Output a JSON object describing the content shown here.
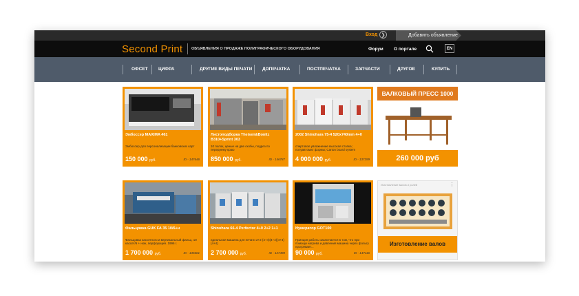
{
  "topbar": {
    "login": "Вход",
    "add_ad": "Добавить объявление"
  },
  "header": {
    "logo": "Second Print",
    "tagline": "ОБЪЯВЛЕНИЯ О ПРОДАЖЕ ПОЛИГРАФИЧЕСКОГО ОБОРУДОВАНИЯ",
    "forum": "Форум",
    "about": "О портале",
    "lang": "EN"
  },
  "nav": [
    "ОФСЕТ",
    "ЦИФРА",
    "ДРУГИЕ ВИДЫ ПЕЧАТИ",
    "ДОПЕЧАТКА",
    "ПОСТПЕЧАТКА",
    "ЗАПЧАСТИ",
    "ДРУГОЕ",
    "КУПИТЬ"
  ],
  "cards": [
    {
      "title": "Эмбоссер MAXIMA 461",
      "desc": "Эмбоссер для персонализации банковских карт",
      "price": "150 000",
      "currency": "руб.",
      "id": "ID - 147646"
    },
    {
      "title": "Листоподборка Theisen&Bonitz B310+Sprint 303",
      "desc": "10 полок, ценые на две скобы, подрез по переднему краю",
      "price": "850 000",
      "currency": "руб.",
      "id": "ID - 146787"
    },
    {
      "title": "2002 Shinohara 75-4 520x740mm 4+0",
      "desc": "спиртовое увлажнение высокая стопка; полуавтомат формы; Carton board system",
      "price": "4 000 000",
      "currency": "руб.",
      "id": "ID - 137399"
    },
    {
      "title": "Фальцовка GUK FA 35 10/6+н",
      "desc": "Фальцовка кассетного и вертикальный фальц. 10 кассет/6 + нож, перфорация. 1996 г.",
      "price": "1 700 000",
      "currency": "руб.",
      "id": "ID - 135601"
    },
    {
      "title": "Shinohara 66-4 Perfector 4+0 2+2 1+1",
      "desc": "идеальная машина для печати 2+2 (4+4)(4+4)(4+4) (4+4)",
      "price": "2 700 000",
      "currency": "руб.",
      "id": "ID - 127490"
    },
    {
      "title": "Нумератор GOT100",
      "desc": "Принцип работы заключается в том, что при помощи нагрева и давления машина через фольгу прогревает...",
      "price": "90 000",
      "currency": "руб.",
      "id": "ID - 147116"
    }
  ],
  "banner1": {
    "title": "ВАЛКОВЫЙ ПРЕСС 1000",
    "price": "260 000 руб"
  },
  "banner2": {
    "caption": "Изготовление валов",
    "small": "Изготовление валов и ролей"
  },
  "colors": {
    "accent": "#f39200",
    "nav_bg": "#4f5b6a",
    "header_bg": "#0d0d0d",
    "topbar_bg": "#2a2a2a"
  },
  "icons": [
    "arrow-right-circle-icon",
    "search-icon"
  ]
}
